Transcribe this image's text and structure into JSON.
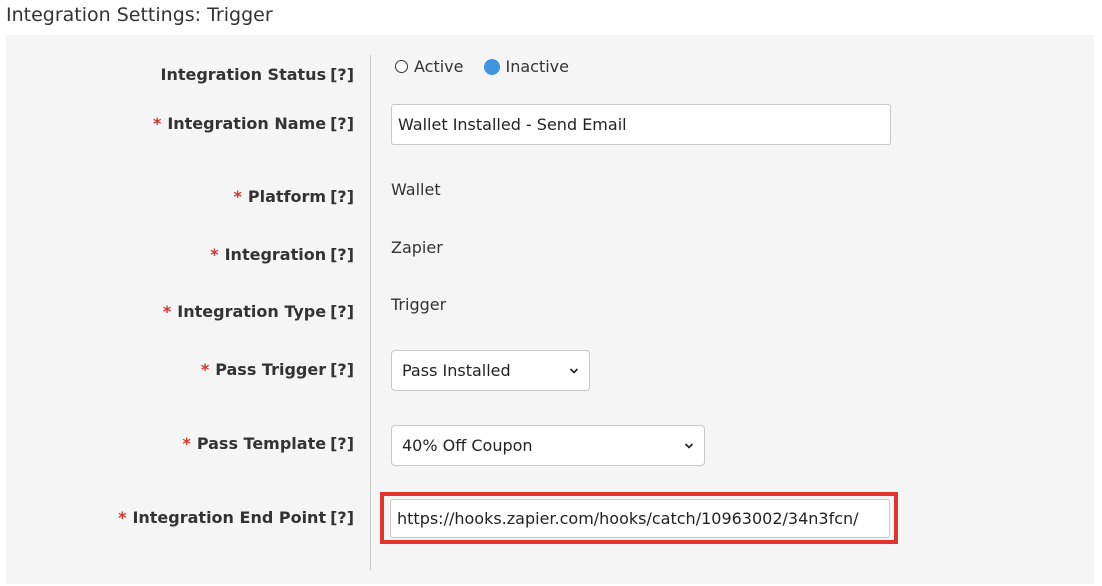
{
  "page": {
    "title": "Integration Settings: Trigger"
  },
  "colors": {
    "required": "#d0342c",
    "radio_selected": "#3d95e0",
    "highlight_border": "#e3352b",
    "panel_bg": "#f5f5f5"
  },
  "form": {
    "required_marker": "*",
    "help_marker": "[?]",
    "status": {
      "label": "Integration Status",
      "options": [
        "Active",
        "Inactive"
      ],
      "selected": "Inactive"
    },
    "name": {
      "label": "Integration Name",
      "value": "Wallet Installed - Send Email"
    },
    "platform": {
      "label": "Platform",
      "value": "Wallet"
    },
    "integration": {
      "label": "Integration",
      "value": "Zapier"
    },
    "integration_type": {
      "label": "Integration Type",
      "value": "Trigger"
    },
    "pass_trigger": {
      "label": "Pass Trigger",
      "selected": "Pass Installed"
    },
    "pass_template": {
      "label": "Pass Template",
      "selected": "40% Off Coupon"
    },
    "end_point": {
      "label": "Integration End Point",
      "value": "https://hooks.zapier.com/hooks/catch/10963002/34n3fcn/"
    }
  }
}
